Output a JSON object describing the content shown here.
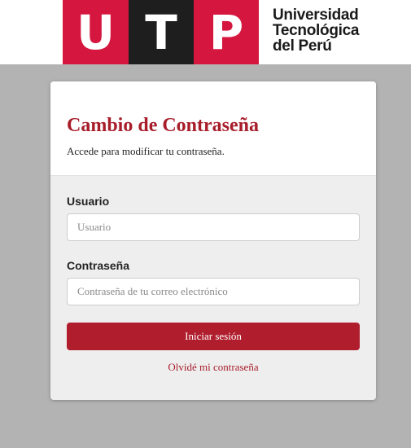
{
  "brand": {
    "logo_letters": [
      "U",
      "T",
      "P"
    ],
    "name_lines": [
      "Universidad",
      "Tecnológica",
      "del Perú"
    ],
    "colors": {
      "red": "#d5173f",
      "black": "#1e1e1e"
    }
  },
  "card": {
    "title": "Cambio de Contraseña",
    "subtitle": "Accede para modificar tu contraseña."
  },
  "form": {
    "username_label": "Usuario",
    "username_placeholder": "Usuario",
    "username_value": "",
    "password_label": "Contraseña",
    "password_placeholder": "Contraseña de tu correo electrónico",
    "password_value": "",
    "submit_label": "Iniciar sesión",
    "forgot_label": "Olvidé mi contraseña"
  },
  "colors": {
    "accent": "#b01e2e",
    "background": "#b3b3b3"
  }
}
